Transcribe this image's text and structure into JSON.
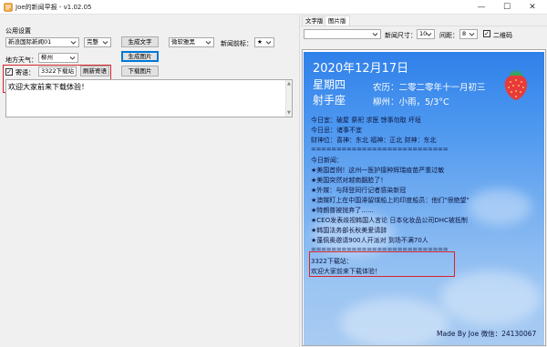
{
  "window": {
    "title": "Joe的新闻早报 - v1.02.05",
    "buttons": {
      "minimize": "—",
      "maximize": "☐",
      "close": "✕"
    }
  },
  "left": {
    "group_label": "公用设置",
    "news_source": "新浪国际新闻01",
    "mode": "完整",
    "generate_text_label": "生成文字",
    "font": "微软雅黑",
    "news_prefix_label": "新闻前标：",
    "news_prefix": "★",
    "weather_label": "地方天气：",
    "city": "柳州",
    "generate_image_label": "生成图片",
    "message_label": "寄语：",
    "message_checked": true,
    "download_btn_label": "3322下载站",
    "refresh_message_label": "刷新寄语",
    "download_image_label": "下载图片",
    "message_text": "欢迎大家前来下载体验！"
  },
  "right": {
    "tabs": [
      {
        "label": "文字版",
        "active": false
      },
      {
        "label": "图片版",
        "active": true
      }
    ],
    "empty_select": "",
    "news_size_label": "新闻尺寸：",
    "news_size": "10",
    "gap_label": "间距：",
    "gap": "8",
    "qrcode_label": "二维码",
    "qrcode_checked": true
  },
  "poster": {
    "date": "2020年12月17日",
    "weekday": "星期四",
    "lunar": "农历：二零二零年十一月初三",
    "zodiac": "射手座",
    "weather": "柳州：小雨，5/3°C",
    "yi": "今日宜：破屋 祭祀 求医 馀事勿取 坏垣",
    "ji": "今日忌：诸事不宜",
    "wealth": "财神位：喜神：东北 福神：正北 财神：东北",
    "separator": "===========================",
    "news_title": "今日新闻：",
    "news": [
      "★美国首例！这州一医护接种辉瑞疫苗严重过敏",
      "★美国突然对越南翻脸了！",
      "★外媒：与拜登同行记者感染新冠",
      "★澳媒盯上在中国滞留煤船上的印度船员：他们\"很绝望\"",
      "★特朗普被抛弃了......",
      "★CEO发表歧视韩国人言论 日本化妆品公司DHC被抵制",
      "★韩国法务部长秋美爱请辞",
      "★蓬佩奥邀请900人开派对 到场不满70人"
    ],
    "separator2": "===========================",
    "msg_line1": "3322下载站：",
    "msg_line2": "欢迎大家前来下载体验！",
    "footer": "Made By Joe 微信：24130067"
  },
  "colors": {
    "highlight": "#d8232a",
    "sky_top": "#2f80ea",
    "sky_bottom": "#a8cbf2",
    "dark_text": "#0d1640"
  },
  "icons": {
    "app": "newspaper-icon",
    "strawberry": "strawberry-icon"
  }
}
